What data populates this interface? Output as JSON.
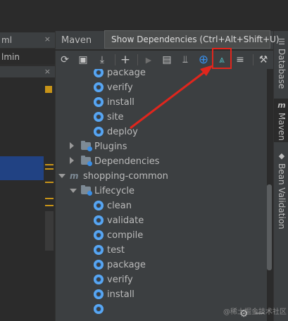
{
  "left_tabs": [
    {
      "label": "ml",
      "close": "×"
    },
    {
      "label": "lmin",
      "close": ""
    }
  ],
  "left_tab3_close": "×",
  "maven": {
    "title": "Maven",
    "tooltip": "Show Dependencies (Ctrl+Alt+Shift+U)",
    "toolbar": [
      {
        "name": "reload-icon",
        "glyph": "⟳"
      },
      {
        "name": "generate-sources-icon",
        "glyph": "▣"
      },
      {
        "name": "download-icon",
        "glyph": "⤓"
      },
      {
        "name": "add-icon",
        "glyph": "+"
      },
      {
        "name": "run-icon",
        "glyph": "▶"
      },
      {
        "name": "execute-goal-icon",
        "glyph": "▤"
      },
      {
        "name": "toggle-offline-icon",
        "glyph": "⫫"
      },
      {
        "name": "skip-tests-icon",
        "glyph": "⊕"
      },
      {
        "name": "show-dependencies-icon",
        "glyph": "⩓"
      },
      {
        "name": "collapse-all-icon",
        "glyph": "≡"
      },
      {
        "name": "settings-wrench-icon",
        "glyph": "⚒"
      }
    ],
    "tree": [
      {
        "kind": "goal",
        "label": "package",
        "level": 3
      },
      {
        "kind": "goal",
        "label": "verify",
        "level": 3
      },
      {
        "kind": "goal",
        "label": "install",
        "level": 3
      },
      {
        "kind": "goal",
        "label": "site",
        "level": 3
      },
      {
        "kind": "goal",
        "label": "deploy",
        "level": 3
      },
      {
        "kind": "folder",
        "label": "Plugins",
        "level": 2,
        "arrow": "right"
      },
      {
        "kind": "folder",
        "label": "Dependencies",
        "level": 2,
        "arrow": "right"
      },
      {
        "kind": "module",
        "label": "shopping-common",
        "level": 1,
        "arrow": "down"
      },
      {
        "kind": "folder",
        "label": "Lifecycle",
        "level": 2,
        "arrow": "down"
      },
      {
        "kind": "goal",
        "label": "clean",
        "level": 3
      },
      {
        "kind": "goal",
        "label": "validate",
        "level": 3
      },
      {
        "kind": "goal",
        "label": "compile",
        "level": 3
      },
      {
        "kind": "goal",
        "label": "test",
        "level": 3
      },
      {
        "kind": "goal",
        "label": "package",
        "level": 3
      },
      {
        "kind": "goal",
        "label": "verify",
        "level": 3
      },
      {
        "kind": "goal",
        "label": "install",
        "level": 3
      },
      {
        "kind": "goal",
        "label": "",
        "level": 3
      }
    ]
  },
  "right_stripe": [
    {
      "label": "Database",
      "icon": "☰"
    },
    {
      "label": "Maven",
      "icon": "m"
    },
    {
      "label": "Bean Validation",
      "icon": "◆"
    }
  ],
  "bottom": {
    "gear": "⚙",
    "dash": "—"
  },
  "watermark": "@稀土掘金技术社区",
  "colors": {
    "accent_blue": "#3a8ee6",
    "highlight_red": "#e0261d",
    "panel": "#3c3f41",
    "editor": "#2b2b2b"
  }
}
